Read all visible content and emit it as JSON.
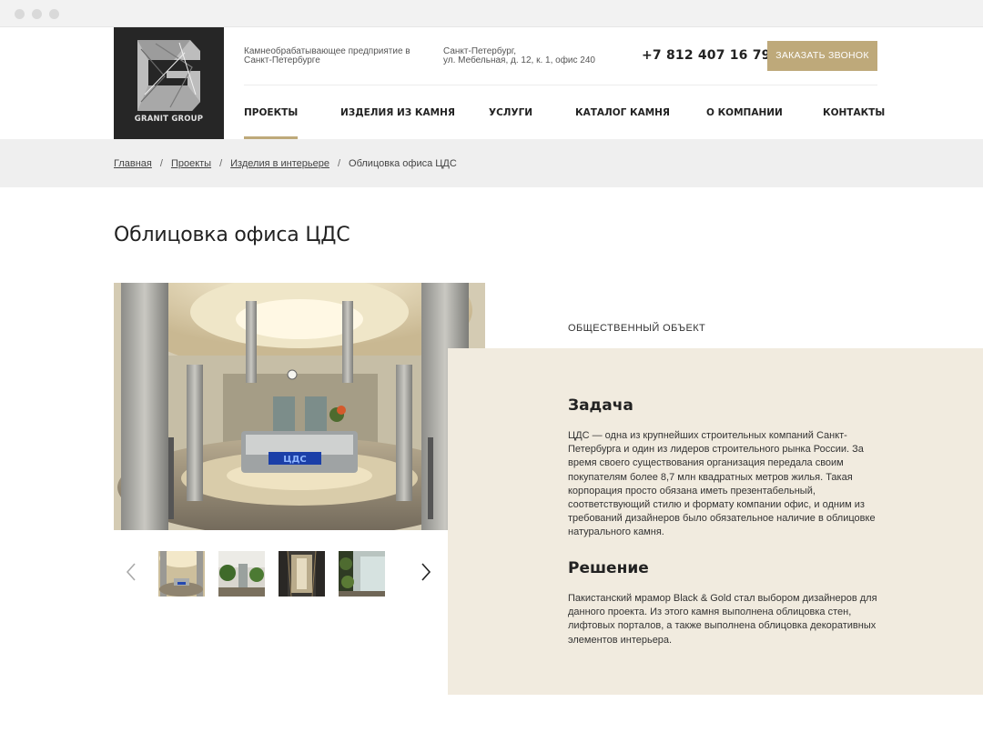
{
  "browser": {
    "controls": [
      "close",
      "minimize",
      "maximize"
    ]
  },
  "logo": {
    "text": "GRANIT GROUP",
    "icon": "granit-g-logo-icon"
  },
  "header": {
    "tagline": "Камнеобрабатывающее предприятие в Санкт-Петербурге",
    "address_line1": "Санкт-Петербург,",
    "address_line2": "ул. Мебельная, д. 12, к. 1, офис 240",
    "phone": "+7 812 407 16 79",
    "callback_label": "ЗАКАЗАТЬ ЗВОНОК"
  },
  "nav": {
    "items": [
      {
        "label": "ПРОЕКТЫ",
        "active": true
      },
      {
        "label": "ИЗДЕЛИЯ ИЗ КАМНЯ",
        "active": false
      },
      {
        "label": "УСЛУГИ",
        "active": false
      },
      {
        "label": "КАТАЛОГ КАМНЯ",
        "active": false
      },
      {
        "label": "О КОМПАНИИ",
        "active": false
      },
      {
        "label": "КОНТАКТЫ",
        "active": false
      }
    ]
  },
  "breadcrumb": {
    "items": [
      {
        "label": "Главная"
      },
      {
        "label": "Проекты"
      },
      {
        "label": "Изделия в интерьере"
      }
    ],
    "current": "Облицовка офиса ЦДС",
    "separator": "/"
  },
  "page": {
    "title": "Облицовка офиса ЦДС"
  },
  "gallery": {
    "prev_icon": "chevron-left-icon",
    "next_icon": "chevron-right-icon",
    "thumbnails": 4,
    "sign_text": "ЦДС"
  },
  "project": {
    "category": "ОБЩЕСТВЕННЫЙ ОБЪЕКТ",
    "task_title": "Задача",
    "task_text": "ЦДС — одна из крупнейших строительных компаний Санкт-Петербурга и один из лидеров строительного рынка России. За время своего существования организация передала своим покупателям более 8,7 млн квадратных метров жилья. Такая корпорация просто обязана иметь презентабельный, соответствующий стилю и формату компании офис, и одним из требований дизайнеров было обязательное наличие в облицовке натурального камня.",
    "solution_title": "Решение",
    "solution_text": "Пакистанский мрамор Black & Gold стал выбором дизайнеров для данного проекта. Из этого камня выполнена облицовка стен, лифтовых порталов, а также выполнена облицовка декоративных элементов интерьера."
  },
  "colors": {
    "accent": "#bea97a",
    "panel": "#f1ebdf",
    "breadcrumb_band": "#efefef",
    "logo_bg": "#262626"
  }
}
